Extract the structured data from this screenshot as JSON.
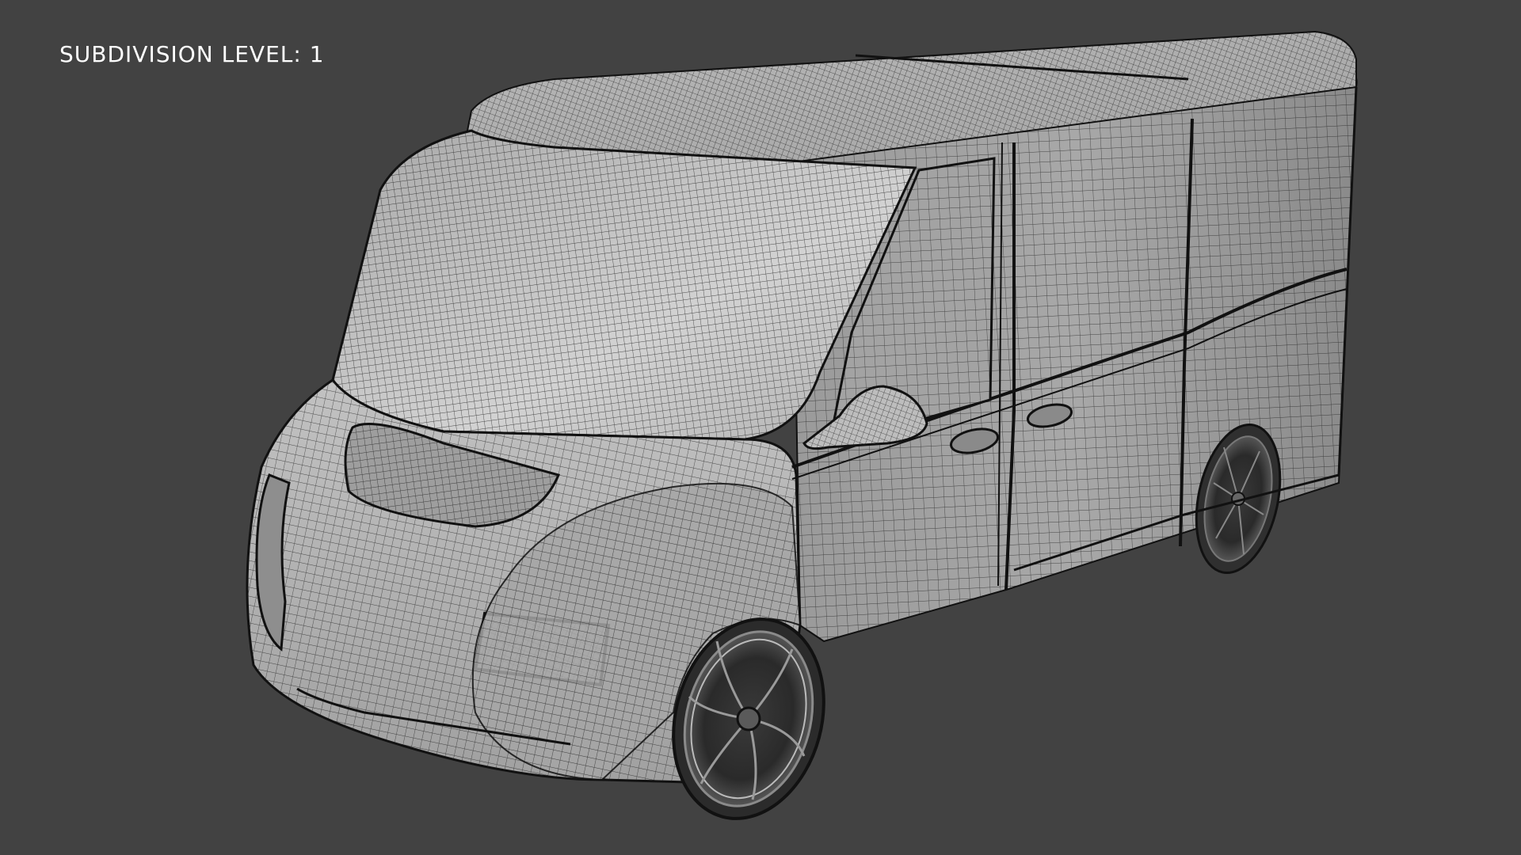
{
  "viewport": {
    "background_color": "#424242",
    "overlay_text": "SUBDIVISION LEVEL: 1",
    "overlay_text_color": "#ffffff"
  },
  "model": {
    "subject": "van",
    "render_style": "wireframe-on-shaded",
    "body_color": "#b4b4b4",
    "wire_color": "#1a1a1a"
  }
}
